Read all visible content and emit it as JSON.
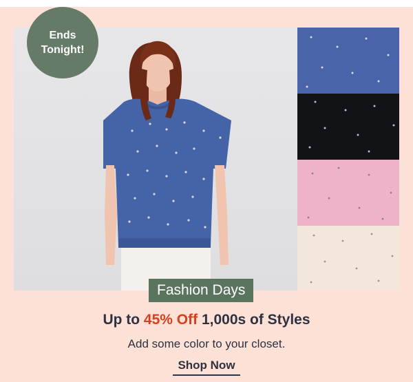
{
  "promo": {
    "badge": {
      "line1": "Ends",
      "line2": "Tonight!"
    },
    "event_label": "Fashion Days",
    "headline": {
      "prefix": "Up to ",
      "highlight": "45% Off",
      "suffix": " 1,000s of Styles"
    },
    "subheadline": "Add some color to your closet.",
    "cta_label": "Shop Now"
  },
  "product": {
    "image_subject": "model-wearing-embellished-tee",
    "swatches": [
      {
        "name": "blue",
        "color": "#4a64aa"
      },
      {
        "name": "black",
        "color": "#121316"
      },
      {
        "name": "pink",
        "color": "#efb3c9"
      },
      {
        "name": "cream",
        "color": "#f3e6da"
      }
    ]
  },
  "colors": {
    "page_background": "#fde1d6",
    "badge_background": "#657a67",
    "event_tag_background": "#5a745e",
    "headline_text": "#2d3140",
    "accent_red": "#d5401e"
  }
}
